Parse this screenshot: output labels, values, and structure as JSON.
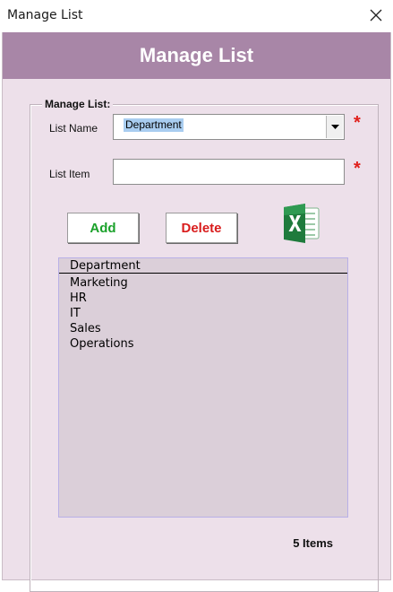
{
  "window": {
    "title": "Manage List"
  },
  "banner": {
    "title": "Manage List"
  },
  "frame": {
    "caption": "Manage List:"
  },
  "fields": {
    "list_name_label": "List Name",
    "list_name_value": "Department",
    "list_item_label": "List Item",
    "list_item_value": "",
    "required_marker": "*"
  },
  "buttons": {
    "add": "Add",
    "delete": "Delete"
  },
  "listbox": {
    "header": "Department",
    "items": [
      "Marketing",
      "HR",
      "IT",
      "Sales",
      "Operations"
    ]
  },
  "status": {
    "count": "5 Items"
  },
  "colors": {
    "banner": "#a886a7",
    "form_bg": "#ede0ea",
    "add_text": "#1aa12a",
    "delete_text": "#d91c1c",
    "required": "#e0201c",
    "excel_green": "#1e7b3c"
  },
  "icons": {
    "close": "close-icon",
    "dropdown": "chevron-down-icon",
    "export": "excel-icon"
  }
}
